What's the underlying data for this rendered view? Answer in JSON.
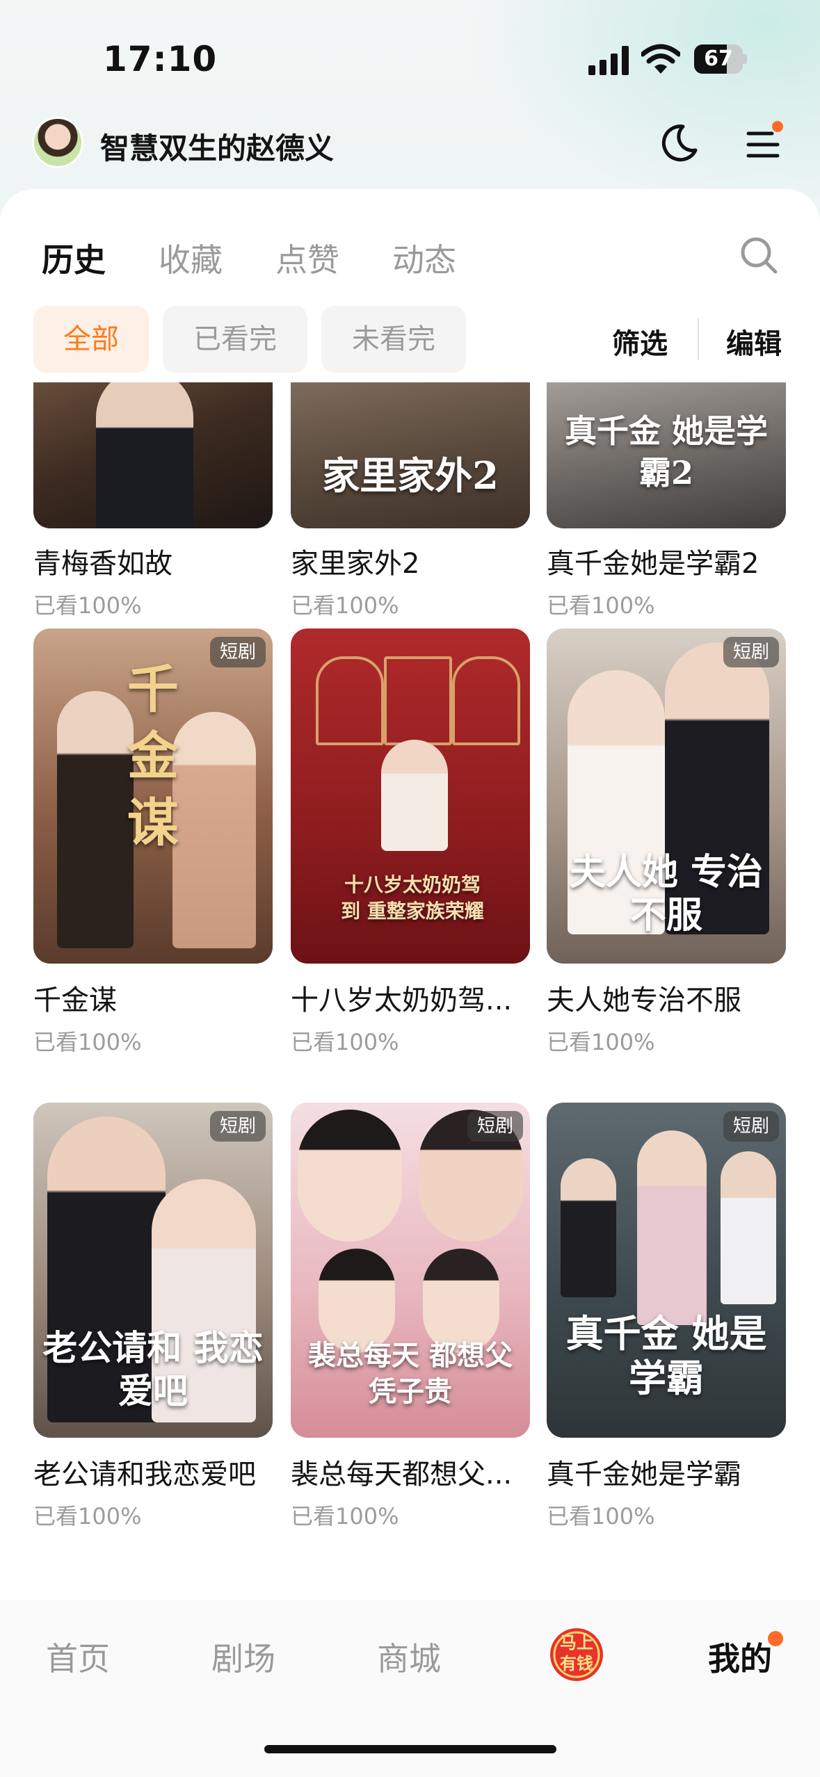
{
  "status_bar": {
    "time": "17:10",
    "battery": "67",
    "battery_level": 0.67
  },
  "profile": {
    "username": "智慧双生的赵德义"
  },
  "tabs": [
    {
      "label": "历史",
      "active": true
    },
    {
      "label": "收藏",
      "active": false
    },
    {
      "label": "点赞",
      "active": false
    },
    {
      "label": "动态",
      "active": false
    }
  ],
  "filters": [
    {
      "label": "全部",
      "active": true
    },
    {
      "label": "已看完",
      "active": false
    },
    {
      "label": "未看完",
      "active": false
    }
  ],
  "actions": {
    "filter": "筛选",
    "edit": "编辑"
  },
  "items": [
    {
      "title": "青梅香如故",
      "progress": "已看100%",
      "badge": "",
      "poster_text": ""
    },
    {
      "title": "家里家外2",
      "progress": "已看100%",
      "badge": "",
      "poster_text": "家里家外2"
    },
    {
      "title": "真千金她是学霸2",
      "progress": "已看100%",
      "badge": "",
      "poster_text": "真千金 她是学霸2"
    },
    {
      "title": "千金谋",
      "progress": "已看100%",
      "badge": "短剧",
      "poster_text": "千金谋"
    },
    {
      "title": "十八岁太奶奶驾...",
      "progress": "已看100%",
      "badge": "",
      "poster_text": "十八岁太奶奶驾到 重整家族荣耀"
    },
    {
      "title": "夫人她专治不服",
      "progress": "已看100%",
      "badge": "短剧",
      "poster_text": "夫人她 专治不服"
    },
    {
      "title": "老公请和我恋爱吧",
      "progress": "已看100%",
      "badge": "短剧",
      "poster_text": "老公请和 我恋爱吧"
    },
    {
      "title": "裴总每天都想父...",
      "progress": "已看100%",
      "badge": "短剧",
      "poster_text": "裴总每天 都想父凭子贵"
    },
    {
      "title": "真千金她是学霸",
      "progress": "已看100%",
      "badge": "短剧",
      "poster_text": "真千金 她是学霸"
    }
  ],
  "bottom_nav": [
    {
      "label": "首页",
      "active": false
    },
    {
      "label": "剧场",
      "active": false
    },
    {
      "label": "商城",
      "active": false
    },
    {
      "label": "马上有钱",
      "active": false
    },
    {
      "label": "我的",
      "active": true
    }
  ],
  "colors": {
    "accent": "#ff7a1c",
    "dot": "#ff6a2a"
  },
  "icons": [
    "signal-icon",
    "wifi-icon",
    "battery-icon",
    "moon-icon",
    "menu-icon",
    "search-icon",
    "promo-icon"
  ]
}
